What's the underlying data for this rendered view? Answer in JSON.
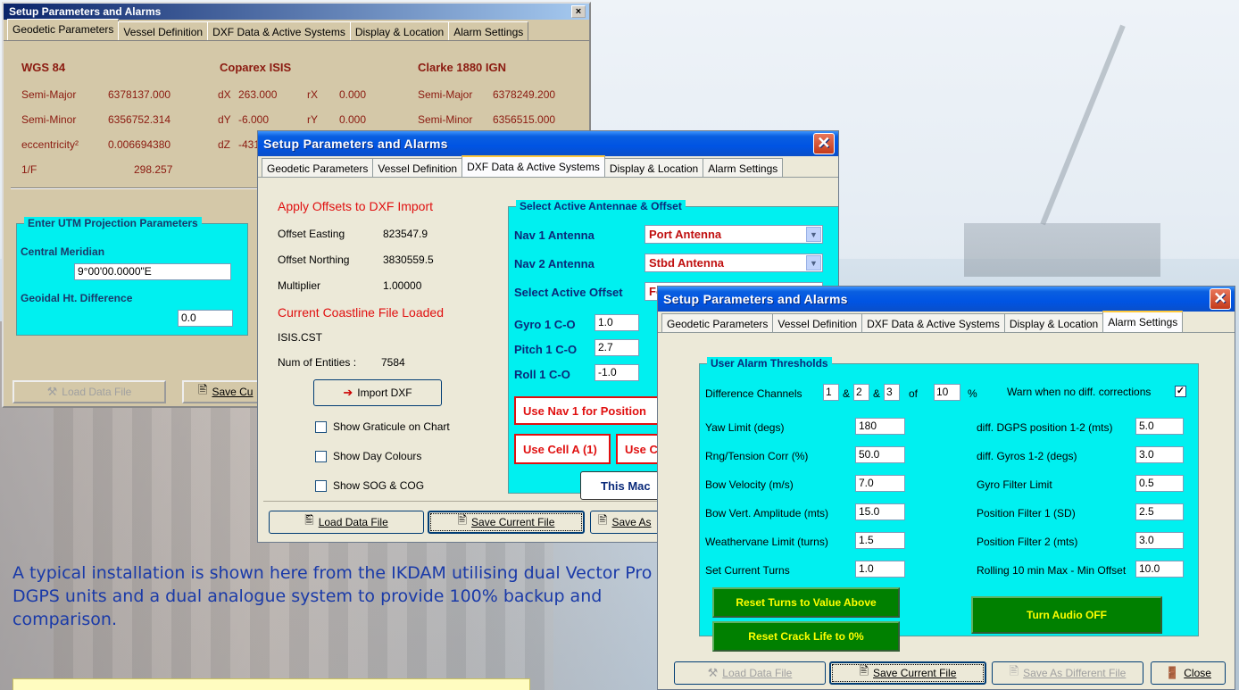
{
  "tabs": [
    "Geodetic Parameters",
    "Vessel Definition",
    "DXF Data & Active Systems",
    "Display & Location",
    "Alarm Settings"
  ],
  "win1": {
    "title": "Setup Parameters and Alarms",
    "close": "×",
    "h1": "WGS 84",
    "h2": "Coparex ISIS",
    "h3": "Clarke 1880 IGN",
    "semimajor_lbl": "Semi-Major",
    "semimajor": "6378137.000",
    "semiminor_lbl": "Semi-Minor",
    "semiminor": "6356752.314",
    "ecc_lbl": "eccentricity²",
    "ecc": "0.006694380",
    "invf_lbl": "1/F",
    "invf": "298.257",
    "dx_lbl": "dX",
    "dx": "263.000",
    "rx_lbl": "rX",
    "rx": "0.000",
    "dy_lbl": "dY",
    "dy": "-6.000",
    "ry_lbl": "rY",
    "ry": "0.000",
    "dz_lbl": "dZ",
    "dz": "-431.0",
    "c_semimajor_lbl": "Semi-Major",
    "c_semimajor": "6378249.200",
    "c_semiminor_lbl": "Semi-Minor",
    "c_semiminor": "6356515.000",
    "utm_title": "Enter UTM Projection Parameters",
    "cm_lbl": "Central Meridian",
    "cm": "9°00'00.0000\"E",
    "geoid_lbl": "Geoidal Ht. Difference",
    "geoid": "0.0",
    "load": "Load Data File",
    "save": "Save Cu"
  },
  "win2": {
    "title": "Setup Parameters and Alarms",
    "apply": "Apply Offsets to DXF Import",
    "oe_lbl": "Offset Easting",
    "oe": "823547.9",
    "on_lbl": "Offset Northing",
    "on": "3830559.5",
    "mult_lbl": "Multiplier",
    "mult": "1.00000",
    "coast": "Current Coastline File Loaded",
    "file": "ISIS.CST",
    "num_lbl": "Num of Entities :",
    "num": "7584",
    "import": "Import DXF",
    "graticule": "Show Graticule on Chart",
    "daycol": "Show Day Colours",
    "sog": "Show SOG & COG",
    "ant_title": "Select Active Antennae & Offset",
    "nav1_lbl": "Nav 1 Antenna",
    "nav1": "Port Antenna",
    "nav2_lbl": "Nav 2 Antenna",
    "nav2": "Stbd Antenna",
    "offset_lbl": "Select Active Offset",
    "offset": "Fo",
    "gyro_lbl": "Gyro 1 C-O",
    "gyro": "1.0",
    "pitch_lbl": "Pitch 1 C-O",
    "pitch": "2.7",
    "roll_lbl": "Roll 1 C-O",
    "roll": "-1.0",
    "usenav": "Use Nav 1 for Position",
    "cella": "Use Cell A (1)",
    "cellb": "Use C",
    "thismac": "This Mac",
    "load": "Load Data File",
    "save": "Save Current File",
    "saveas": "Save As"
  },
  "win3": {
    "title": "Setup Parameters and Alarms",
    "group": "User Alarm Thresholds",
    "diff_lbl": "Difference Channels",
    "d1": "1",
    "amp1": "&",
    "d2": "2",
    "amp2": "&",
    "d3": "3",
    "of": "of",
    "d4": "10",
    "pct": "%",
    "warn_lbl": "Warn when no diff. corrections",
    "warn_chk": "✓",
    "left": [
      {
        "label": "Yaw Limit (degs)",
        "value": "180"
      },
      {
        "label": "Rng/Tension Corr (%)",
        "value": "50.0"
      },
      {
        "label": "Bow Velocity (m/s)",
        "value": "7.0"
      },
      {
        "label": "Bow Vert. Amplitude (mts)",
        "value": "15.0"
      },
      {
        "label": "Weathervane Limit (turns)",
        "value": "1.5"
      },
      {
        "label": "Set Current Turns",
        "value": "1.0"
      }
    ],
    "right": [
      {
        "label": "diff. DGPS position 1-2 (mts)",
        "value": "5.0"
      },
      {
        "label": "diff. Gyros 1-2 (degs)",
        "value": "3.0"
      },
      {
        "label": "Gyro Filter Limit",
        "value": "0.5"
      },
      {
        "label": "Position Filter 1 (SD)",
        "value": "2.5"
      },
      {
        "label": "Position Filter 2 (mts)",
        "value": "3.0"
      },
      {
        "label": "Rolling 10 min Max - Min Offset",
        "value": "10.0"
      }
    ],
    "reset_turns": "Reset Turns to Value Above",
    "reset_crack": "Reset Crack Life to 0%",
    "audio": "Turn Audio OFF",
    "load": "Load Data File",
    "save": "Save Current File",
    "saveas": "Save As Different File",
    "close": "Close"
  },
  "caption": "A typical installation is shown here from the IKDAM utilising dual Vector Pro DGPS units and a dual analogue system to provide 100% backup and comparison."
}
